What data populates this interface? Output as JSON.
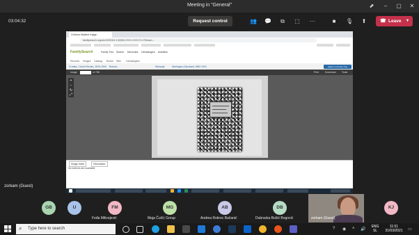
{
  "titlebar": {
    "title": "Meeting in \"General\""
  },
  "meeting": {
    "timer": "03:04:32",
    "request_control": "Request control",
    "leave": "Leave"
  },
  "presenter": "zorkam (Guest)",
  "shared_screen": {
    "tab_title": "Crkvene Matične Knjige - FamilySearch",
    "url": "familysearch.org/ark:/61903/3:1:3Q9M-CSXX-XXXX?i=175&cat=...",
    "site_name": "FamilySearch",
    "nav": [
      "Family Tree",
      "Search",
      "Memories",
      "Genealogies",
      "Activities"
    ],
    "subnav": [
      "Records",
      "Images",
      "Catalog",
      "Books",
      "Wiki",
      "Genealogies"
    ],
    "crumbs": [
      "Croatia, Church Books, 1516-1994",
      "Bosnia...",
      "Mrkopalj",
      "Marriages (Vjenčani) 1882-1941"
    ],
    "blue_button": "Attach to Family Tree",
    "image_label": "Image",
    "image_of": "of 788",
    "print": "Print",
    "download": "Download",
    "tools": "Tools",
    "bottom_tabs": [
      "Image Index",
      "Information"
    ],
    "no_index": "No indexes are available."
  },
  "participants": [
    {
      "initials": "GB",
      "name": "",
      "color": "#a8d5b0"
    },
    {
      "initials": "U",
      "name": "",
      "color": "#a9c3ea"
    },
    {
      "initials": "FM",
      "name": "Feđa Milivojević",
      "color": "#f2b8c6"
    },
    {
      "initials": "MG",
      "name": "Maja Čučić Gorup",
      "color": "#bde0a6"
    },
    {
      "initials": "AB",
      "name": "Andrea Rokrec Bačanić",
      "color": "#c9c9e8"
    },
    {
      "initials": "DB",
      "name": "Dubravka Božić Bogović",
      "color": "#b5dcc5"
    },
    {
      "initials": "KJ",
      "name": "",
      "color": "#f2b8c6"
    }
  ],
  "photo_participant": "zorkam (Guest)",
  "taskbar": {
    "search_placeholder": "Type here to search",
    "lang_1": "ENG",
    "lang_2": "SL",
    "time": "11:51",
    "date": "31/03/2021"
  }
}
